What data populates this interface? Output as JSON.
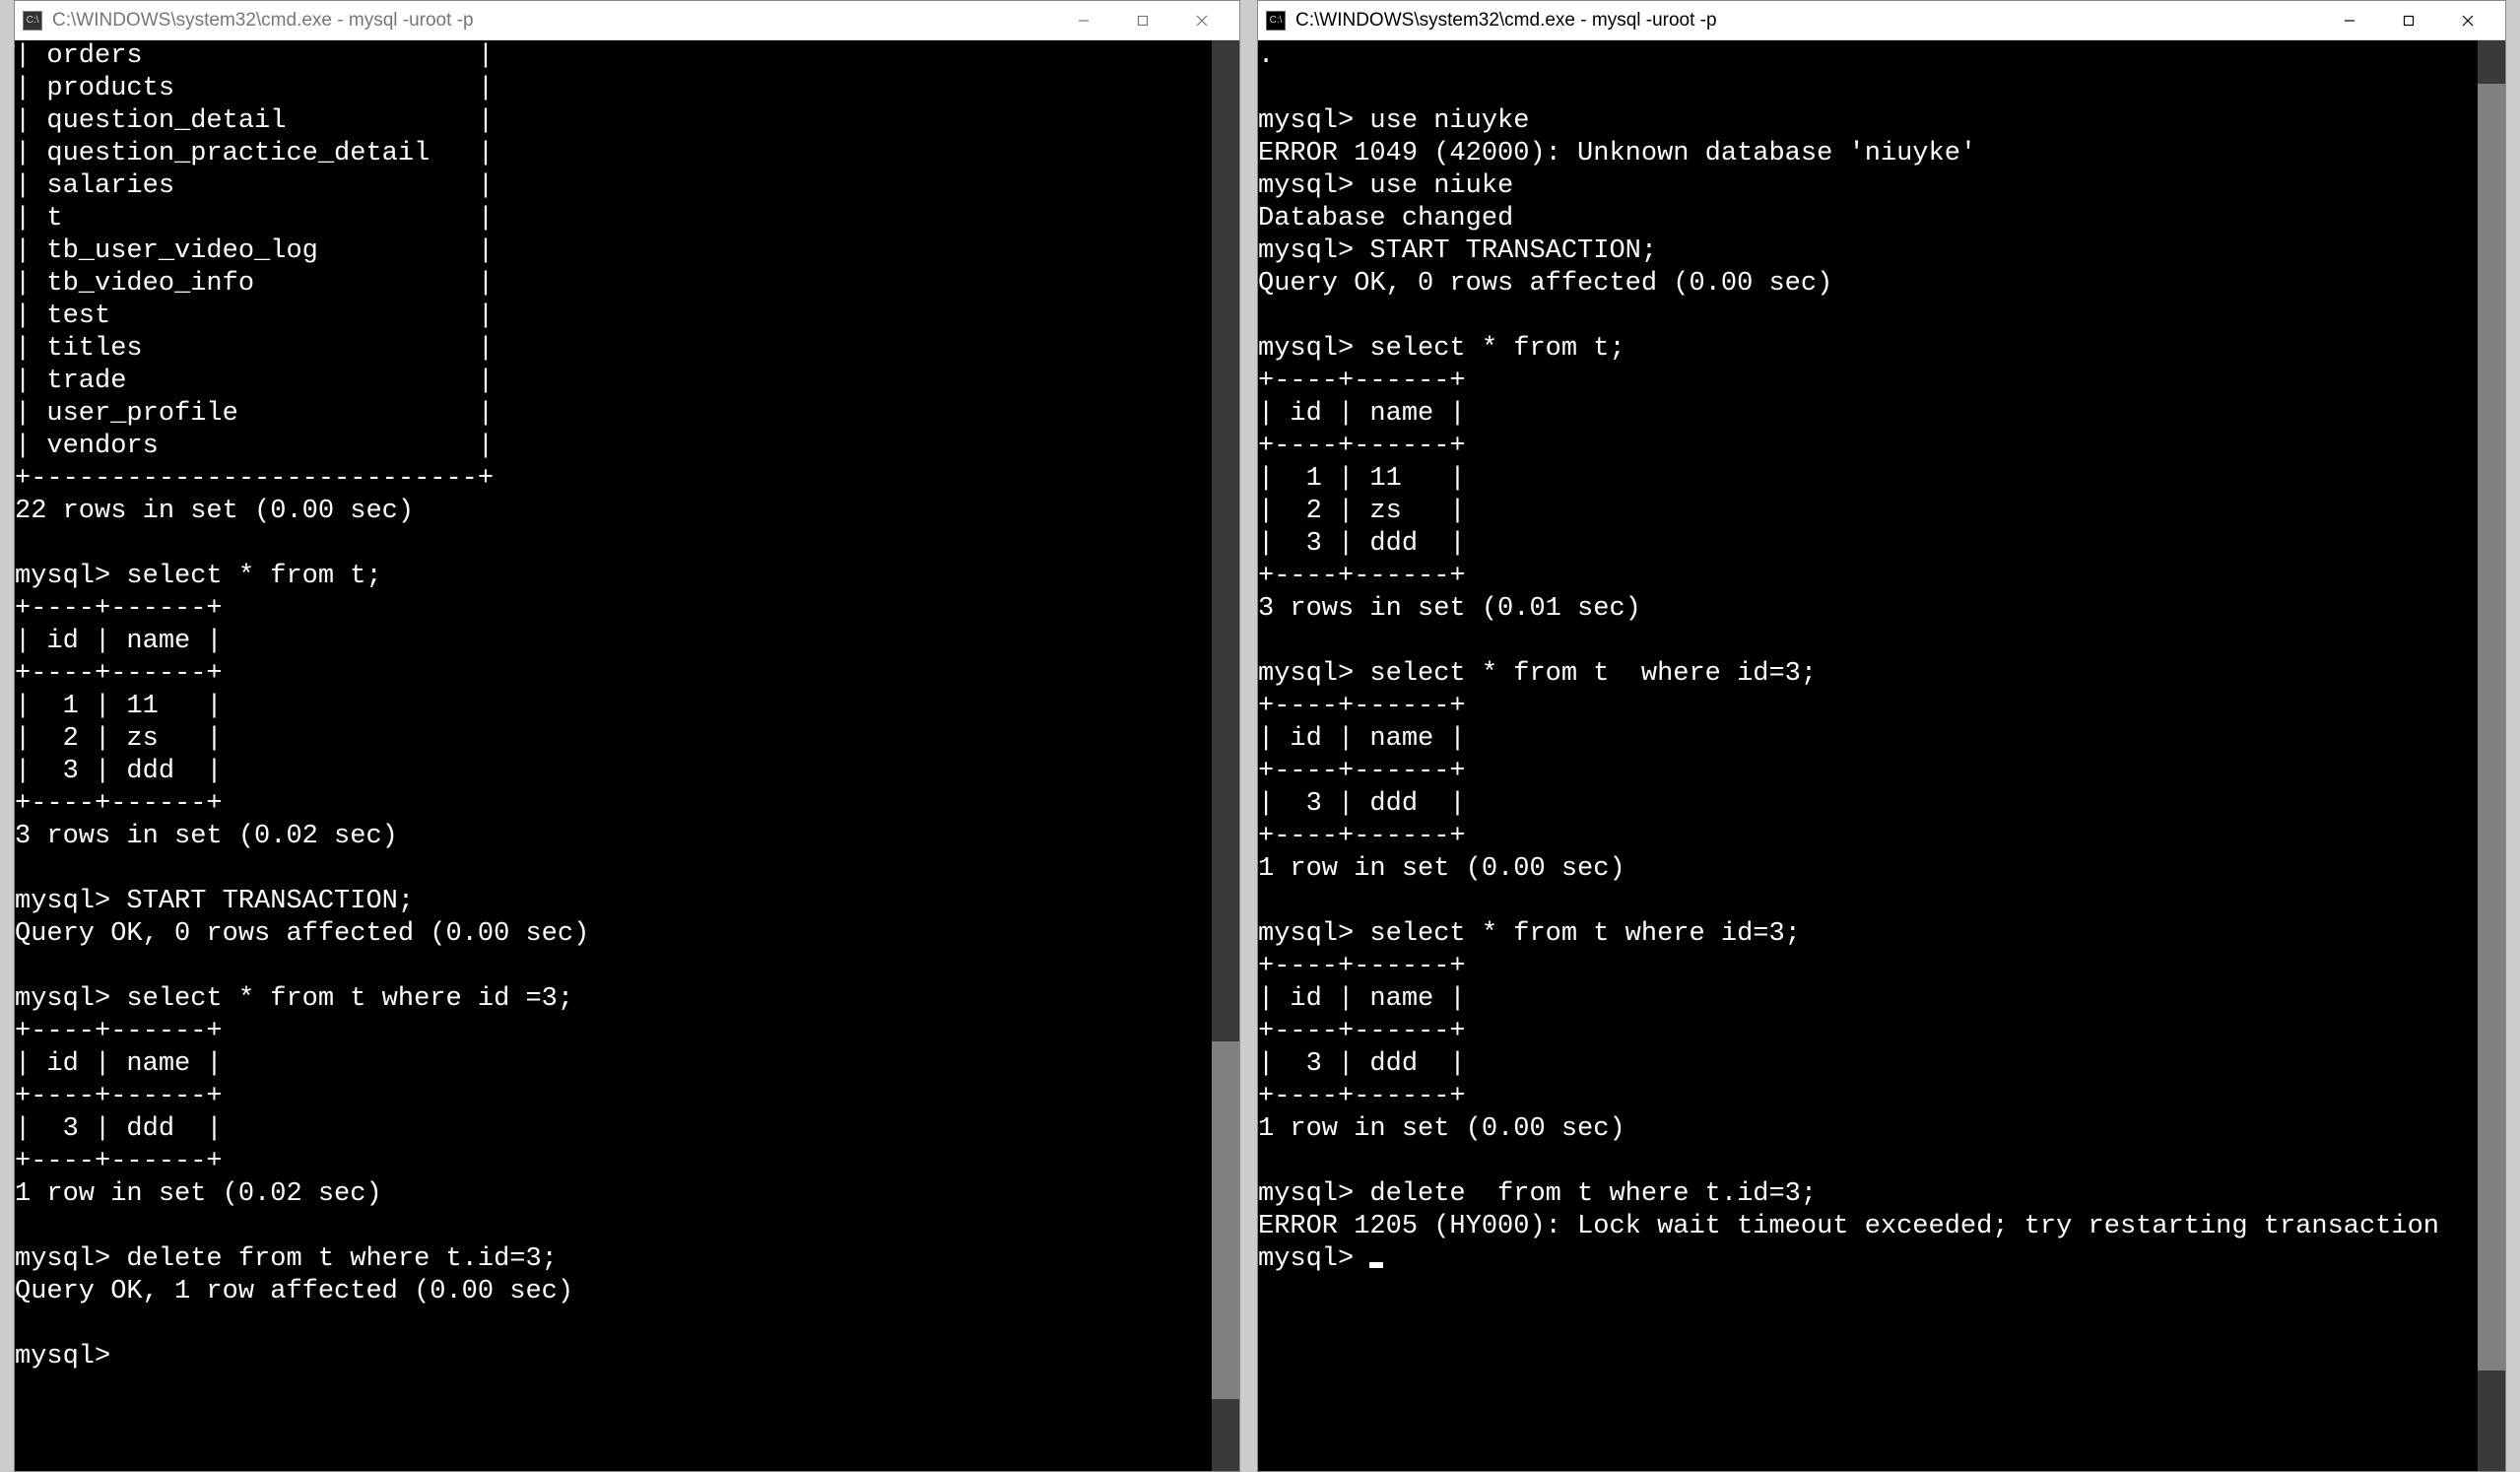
{
  "left_window": {
    "title": "C:\\WINDOWS\\system32\\cmd.exe - mysql  -uroot -p",
    "icon_label": "C:\\",
    "content": "| orders                     |\n| products                   |\n| question_detail            |\n| question_practice_detail   |\n| salaries                   |\n| t                          |\n| tb_user_video_log          |\n| tb_video_info              |\n| test                       |\n| titles                     |\n| trade                      |\n| user_profile               |\n| vendors                    |\n+----------------------------+\n22 rows in set (0.00 sec)\n\nmysql> select * from t;\n+----+------+\n| id | name |\n+----+------+\n|  1 | 11   |\n|  2 | zs   |\n|  3 | ddd  |\n+----+------+\n3 rows in set (0.02 sec)\n\nmysql> START TRANSACTION;\nQuery OK, 0 rows affected (0.00 sec)\n\nmysql> select * from t where id =3;\n+----+------+\n| id | name |\n+----+------+\n|  3 | ddd  |\n+----+------+\n1 row in set (0.02 sec)\n\nmysql> delete from t where t.id=3;\nQuery OK, 1 row affected (0.00 sec)\n\nmysql>"
  },
  "right_window": {
    "title": "C:\\WINDOWS\\system32\\cmd.exe - mysql   -uroot -p",
    "icon_label": "C:\\",
    "content": ".\n\nmysql> use niuyke\nERROR 1049 (42000): Unknown database 'niuyke'\nmysql> use niuke\nDatabase changed\nmysql> START TRANSACTION;\nQuery OK, 0 rows affected (0.00 sec)\n\nmysql> select * from t;\n+----+------+\n| id | name |\n+----+------+\n|  1 | 11   |\n|  2 | zs   |\n|  3 | ddd  |\n+----+------+\n3 rows in set (0.01 sec)\n\nmysql> select * from t  where id=3;\n+----+------+\n| id | name |\n+----+------+\n|  3 | ddd  |\n+----+------+\n1 row in set (0.00 sec)\n\nmysql> select * from t where id=3;\n+----+------+\n| id | name |\n+----+------+\n|  3 | ddd  |\n+----+------+\n1 row in set (0.00 sec)\n\nmysql> delete  from t where t.id=3;\nERROR 1205 (HY000): Lock wait timeout exceeded; try restarting transaction\nmysql> "
  }
}
